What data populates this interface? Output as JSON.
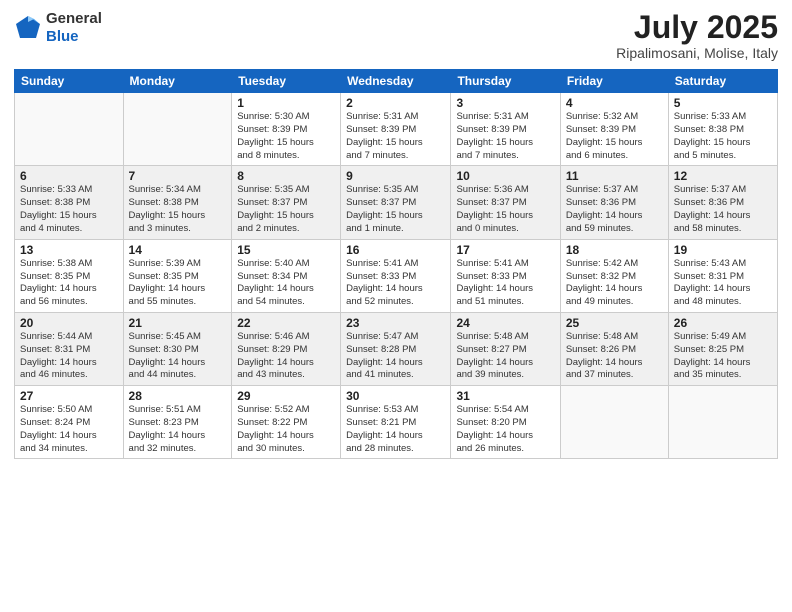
{
  "header": {
    "logo": {
      "line1": "General",
      "line2": "Blue"
    },
    "title": "July 2025",
    "location": "Ripalimosani, Molise, Italy"
  },
  "weekdays": [
    "Sunday",
    "Monday",
    "Tuesday",
    "Wednesday",
    "Thursday",
    "Friday",
    "Saturday"
  ],
  "weeks": [
    [
      {
        "day": "",
        "info": ""
      },
      {
        "day": "",
        "info": ""
      },
      {
        "day": "1",
        "info": "Sunrise: 5:30 AM\nSunset: 8:39 PM\nDaylight: 15 hours\nand 8 minutes."
      },
      {
        "day": "2",
        "info": "Sunrise: 5:31 AM\nSunset: 8:39 PM\nDaylight: 15 hours\nand 7 minutes."
      },
      {
        "day": "3",
        "info": "Sunrise: 5:31 AM\nSunset: 8:39 PM\nDaylight: 15 hours\nand 7 minutes."
      },
      {
        "day": "4",
        "info": "Sunrise: 5:32 AM\nSunset: 8:39 PM\nDaylight: 15 hours\nand 6 minutes."
      },
      {
        "day": "5",
        "info": "Sunrise: 5:33 AM\nSunset: 8:38 PM\nDaylight: 15 hours\nand 5 minutes."
      }
    ],
    [
      {
        "day": "6",
        "info": "Sunrise: 5:33 AM\nSunset: 8:38 PM\nDaylight: 15 hours\nand 4 minutes."
      },
      {
        "day": "7",
        "info": "Sunrise: 5:34 AM\nSunset: 8:38 PM\nDaylight: 15 hours\nand 3 minutes."
      },
      {
        "day": "8",
        "info": "Sunrise: 5:35 AM\nSunset: 8:37 PM\nDaylight: 15 hours\nand 2 minutes."
      },
      {
        "day": "9",
        "info": "Sunrise: 5:35 AM\nSunset: 8:37 PM\nDaylight: 15 hours\nand 1 minute."
      },
      {
        "day": "10",
        "info": "Sunrise: 5:36 AM\nSunset: 8:37 PM\nDaylight: 15 hours\nand 0 minutes."
      },
      {
        "day": "11",
        "info": "Sunrise: 5:37 AM\nSunset: 8:36 PM\nDaylight: 14 hours\nand 59 minutes."
      },
      {
        "day": "12",
        "info": "Sunrise: 5:37 AM\nSunset: 8:36 PM\nDaylight: 14 hours\nand 58 minutes."
      }
    ],
    [
      {
        "day": "13",
        "info": "Sunrise: 5:38 AM\nSunset: 8:35 PM\nDaylight: 14 hours\nand 56 minutes."
      },
      {
        "day": "14",
        "info": "Sunrise: 5:39 AM\nSunset: 8:35 PM\nDaylight: 14 hours\nand 55 minutes."
      },
      {
        "day": "15",
        "info": "Sunrise: 5:40 AM\nSunset: 8:34 PM\nDaylight: 14 hours\nand 54 minutes."
      },
      {
        "day": "16",
        "info": "Sunrise: 5:41 AM\nSunset: 8:33 PM\nDaylight: 14 hours\nand 52 minutes."
      },
      {
        "day": "17",
        "info": "Sunrise: 5:41 AM\nSunset: 8:33 PM\nDaylight: 14 hours\nand 51 minutes."
      },
      {
        "day": "18",
        "info": "Sunrise: 5:42 AM\nSunset: 8:32 PM\nDaylight: 14 hours\nand 49 minutes."
      },
      {
        "day": "19",
        "info": "Sunrise: 5:43 AM\nSunset: 8:31 PM\nDaylight: 14 hours\nand 48 minutes."
      }
    ],
    [
      {
        "day": "20",
        "info": "Sunrise: 5:44 AM\nSunset: 8:31 PM\nDaylight: 14 hours\nand 46 minutes."
      },
      {
        "day": "21",
        "info": "Sunrise: 5:45 AM\nSunset: 8:30 PM\nDaylight: 14 hours\nand 44 minutes."
      },
      {
        "day": "22",
        "info": "Sunrise: 5:46 AM\nSunset: 8:29 PM\nDaylight: 14 hours\nand 43 minutes."
      },
      {
        "day": "23",
        "info": "Sunrise: 5:47 AM\nSunset: 8:28 PM\nDaylight: 14 hours\nand 41 minutes."
      },
      {
        "day": "24",
        "info": "Sunrise: 5:48 AM\nSunset: 8:27 PM\nDaylight: 14 hours\nand 39 minutes."
      },
      {
        "day": "25",
        "info": "Sunrise: 5:48 AM\nSunset: 8:26 PM\nDaylight: 14 hours\nand 37 minutes."
      },
      {
        "day": "26",
        "info": "Sunrise: 5:49 AM\nSunset: 8:25 PM\nDaylight: 14 hours\nand 35 minutes."
      }
    ],
    [
      {
        "day": "27",
        "info": "Sunrise: 5:50 AM\nSunset: 8:24 PM\nDaylight: 14 hours\nand 34 minutes."
      },
      {
        "day": "28",
        "info": "Sunrise: 5:51 AM\nSunset: 8:23 PM\nDaylight: 14 hours\nand 32 minutes."
      },
      {
        "day": "29",
        "info": "Sunrise: 5:52 AM\nSunset: 8:22 PM\nDaylight: 14 hours\nand 30 minutes."
      },
      {
        "day": "30",
        "info": "Sunrise: 5:53 AM\nSunset: 8:21 PM\nDaylight: 14 hours\nand 28 minutes."
      },
      {
        "day": "31",
        "info": "Sunrise: 5:54 AM\nSunset: 8:20 PM\nDaylight: 14 hours\nand 26 minutes."
      },
      {
        "day": "",
        "info": ""
      },
      {
        "day": "",
        "info": ""
      }
    ]
  ]
}
